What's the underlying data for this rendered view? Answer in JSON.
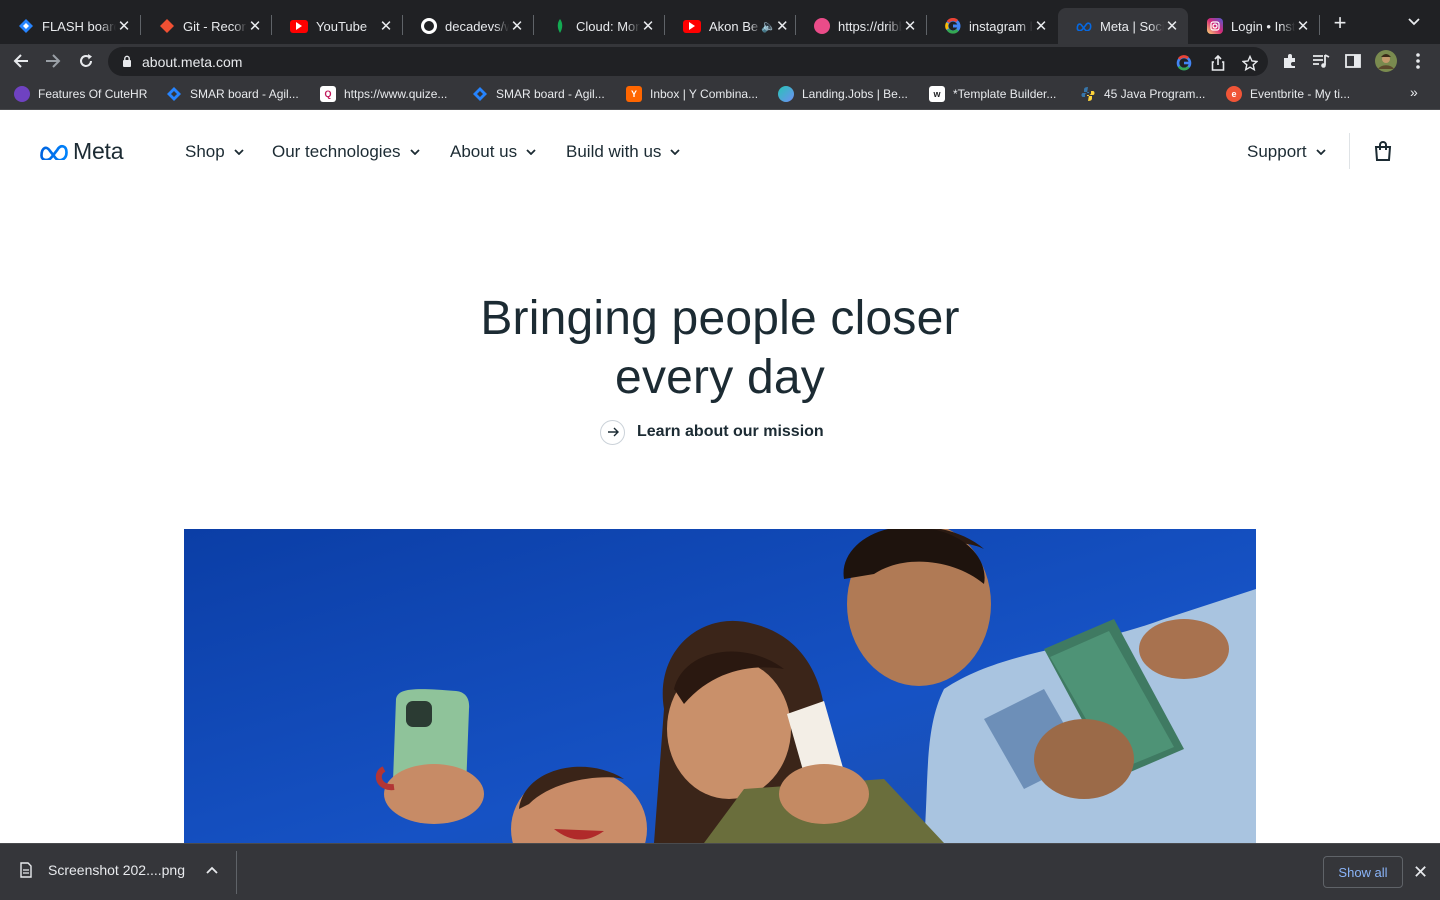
{
  "browser": {
    "tabs": [
      {
        "title": "FLASH board",
        "icon": "jira-icon",
        "color": "#2684ff",
        "active": false
      },
      {
        "title": "Git - Recording",
        "icon": "git-icon",
        "color": "#f05033",
        "active": false
      },
      {
        "title": "YouTube",
        "icon": "youtube-icon",
        "color": "#ff0000",
        "active": false
      },
      {
        "title": "decadevs/w",
        "icon": "github-icon",
        "color": "#ffffff",
        "active": false
      },
      {
        "title": "Cloud: Mongo",
        "icon": "mongodb-icon",
        "color": "#13aa52",
        "active": false
      },
      {
        "title": "Akon Be",
        "icon": "youtube-icon",
        "color": "#ff0000",
        "active": false,
        "audio": true
      },
      {
        "title": "https://dribbble",
        "icon": "dribbble-icon",
        "color": "#ea4c89",
        "active": false
      },
      {
        "title": "instagram la",
        "icon": "google-icon",
        "color": "#4285f4",
        "active": false
      },
      {
        "title": "Meta | Social",
        "icon": "meta-icon",
        "color": "#0668e1",
        "active": true
      },
      {
        "title": "Login • Insta",
        "icon": "instagram-icon",
        "color": "#e1306c",
        "active": false
      }
    ],
    "url": "about.meta.com",
    "bookmarks": [
      {
        "label": "Features Of CuteHR",
        "icon": "cutehr-icon",
        "color": "#6f42c1"
      },
      {
        "label": "SMAR board - Agil...",
        "icon": "jira-icon",
        "color": "#2684ff"
      },
      {
        "label": "https://www.quize...",
        "icon": "quizizz-icon",
        "color": "#c2185b"
      },
      {
        "label": "SMAR board - Agil...",
        "icon": "jira-icon",
        "color": "#2684ff"
      },
      {
        "label": "Inbox | Y Combina...",
        "icon": "ycombinator-icon",
        "color": "#ff6600"
      },
      {
        "label": "Landing.Jobs | Be...",
        "icon": "landingjobs-icon",
        "color": "#27c4b5"
      },
      {
        "label": "*Template Builder...",
        "icon": "webflow-icon",
        "color": "#ffffff"
      },
      {
        "label": "45 Java Program...",
        "icon": "python-icon",
        "color": "#3776ab"
      },
      {
        "label": "Eventbrite - My ti...",
        "icon": "eventbrite-icon",
        "color": "#f05537"
      }
    ]
  },
  "site": {
    "logo_text": "Meta",
    "nav": [
      "Shop",
      "Our technologies",
      "About us",
      "Build with us"
    ],
    "support": "Support",
    "brand_color": "#1c2b33"
  },
  "hero": {
    "title_line1": "Bringing people closer",
    "title_line2": "every day",
    "cta": "Learn about our mission"
  },
  "downloads": {
    "file": "Screenshot 202....png",
    "show_all": "Show all"
  }
}
